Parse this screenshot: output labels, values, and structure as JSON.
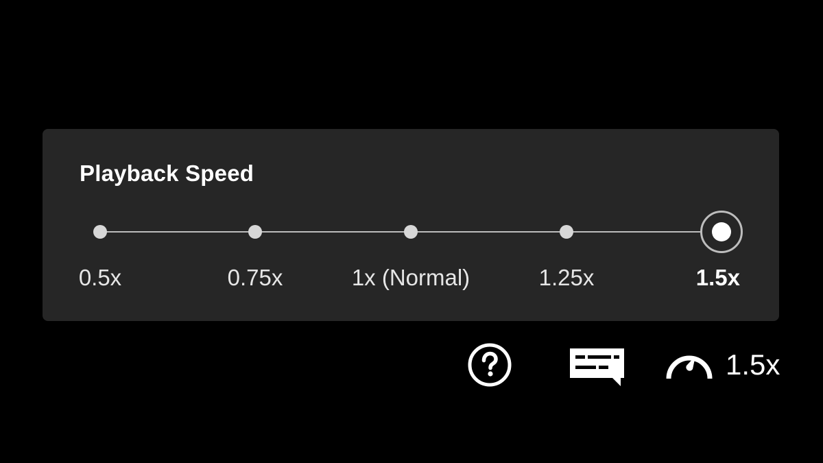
{
  "panel": {
    "title": "Playback Speed",
    "options": [
      {
        "label": "0.5x",
        "selected": false
      },
      {
        "label": "0.75x",
        "selected": false
      },
      {
        "label": "1x (Normal)",
        "selected": false
      },
      {
        "label": "1.25x",
        "selected": false
      },
      {
        "label": "1.5x",
        "selected": true
      }
    ]
  },
  "controls": {
    "help_icon": "help-circle-icon",
    "subtitles_icon": "subtitles-icon",
    "speed_icon": "speedometer-icon",
    "current_speed": "1.5x"
  },
  "colors": {
    "background": "#000000",
    "panel": "#262626",
    "track": "#bdbdbd",
    "dot": "#d7d7d7",
    "text": "#ffffff"
  }
}
